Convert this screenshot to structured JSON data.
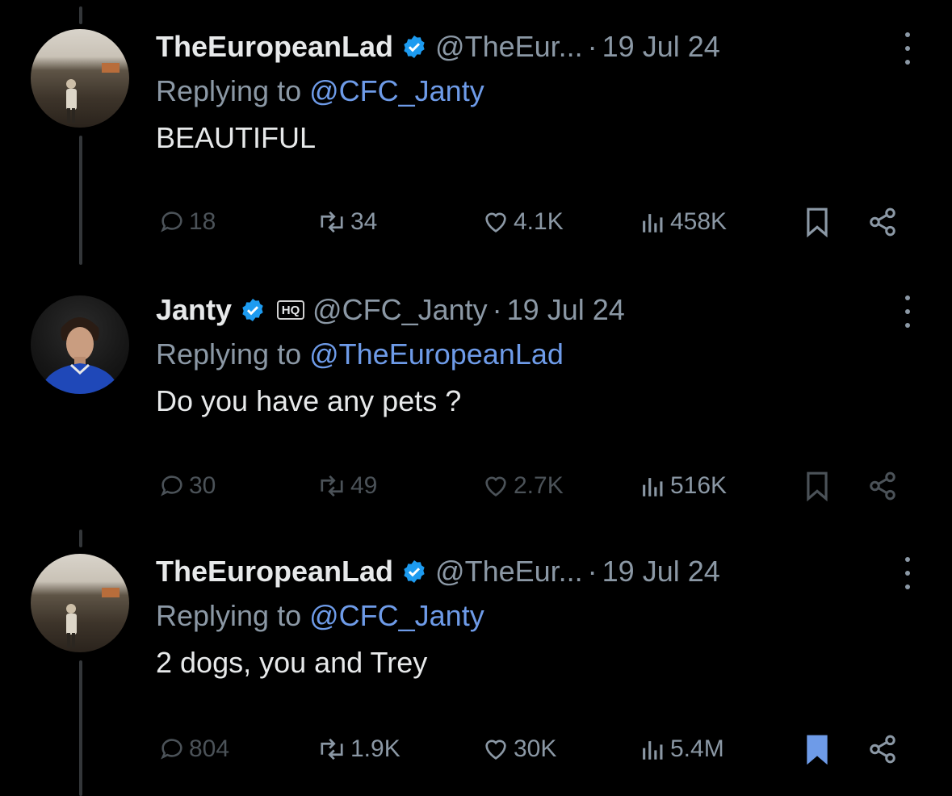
{
  "tweets": [
    {
      "name": "TheEuropeanLad",
      "handle": "@TheEur...",
      "dot": "·",
      "date": "19 Jul 24",
      "replying_prefix": "Replying to ",
      "replying_to": "@CFC_Janty",
      "text": "BEAUTIFUL",
      "stats": {
        "replies": "18",
        "reposts": "34",
        "likes": "4.1K",
        "views": "458K"
      },
      "bookmarked": false
    },
    {
      "name": "Janty",
      "affiliate_badge": "HQ",
      "handle": "@CFC_Janty",
      "dot": "·",
      "date": "19 Jul 24",
      "replying_prefix": "Replying to ",
      "replying_to": "@TheEuropeanLad",
      "text": "Do you have any pets ?",
      "stats": {
        "replies": "30",
        "reposts": "49",
        "likes": "2.7K",
        "views": "516K"
      },
      "bookmarked": false
    },
    {
      "name": "TheEuropeanLad",
      "handle": "@TheEur...",
      "dot": "·",
      "date": "19 Jul 24",
      "replying_prefix": "Replying to ",
      "replying_to": "@CFC_Janty",
      "text": "2 dogs, you and Trey",
      "stats": {
        "replies": "804",
        "reposts": "1.9K",
        "likes": "30K",
        "views": "5.4M"
      },
      "bookmarked": true
    }
  ],
  "colors": {
    "accent": "#6e9be8",
    "secondary_text": "#8b98a5",
    "verified": "#1d9bf0",
    "background": "#000000"
  },
  "icons": [
    "reply-icon",
    "repost-icon",
    "like-icon",
    "views-icon",
    "bookmark-icon",
    "share-icon",
    "verified-icon",
    "more-icon"
  ]
}
